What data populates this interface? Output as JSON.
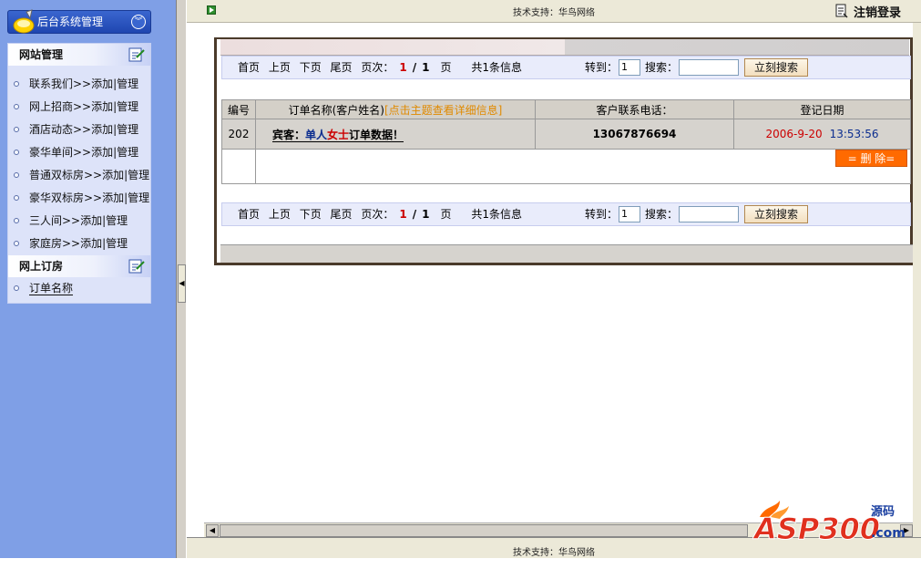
{
  "sidebar": {
    "title": "后台系统管理",
    "sections": [
      {
        "title": "网站管理",
        "items": [
          "联系我们>>添加|管理",
          "网上招商>>添加|管理",
          "酒店动态>>添加|管理",
          "豪华单间>>添加|管理",
          "普通双标房>>添加|管理",
          "豪华双标房>>添加|管理",
          "三人间>>添加|管理",
          "家庭房>>添加|管理"
        ]
      },
      {
        "title": "网上订房",
        "items": [
          "订单名称"
        ]
      }
    ]
  },
  "topbar": {
    "support": "技术支持：华鸟网络",
    "logout": "注销登录"
  },
  "pager": {
    "first": "首页",
    "prev": "上页",
    "next": "下页",
    "last": "尾页",
    "page_label": "页次：",
    "page_current": "1",
    "page_sep": "/",
    "page_total": "1",
    "page_unit": "页",
    "total_text": "共1条信息",
    "jump_label": "转到：",
    "jump_value": "1",
    "search_label": "搜索：",
    "search_value": "",
    "search_button": "立刻搜索"
  },
  "table": {
    "headers": {
      "id": "编号",
      "name": "订单名称(客户姓名)",
      "name_hint": "[点击主题查看详细信息]",
      "phone": "客户联系电话：",
      "date": "登记日期"
    },
    "rows": [
      {
        "id": "202",
        "name_prefix": "宾客：",
        "name_mid": "单人",
        "name_red": "女士",
        "name_suffix": "订单数据！",
        "phone": "13067876694",
        "date": "2006-9-20",
        "time": "13:53:56"
      }
    ],
    "delete_button": "= 删 除="
  },
  "footer": {
    "support": "技术支持：华鸟网络"
  },
  "watermark": {
    "text": "ASP300",
    "sub": "源码",
    "domain": ".com"
  },
  "colors": {
    "sidebar_bg": "#7f9fe6",
    "accent_red": "#cc0000",
    "delete_orange": "#ff6a00",
    "hint_orange": "#e08a00"
  }
}
